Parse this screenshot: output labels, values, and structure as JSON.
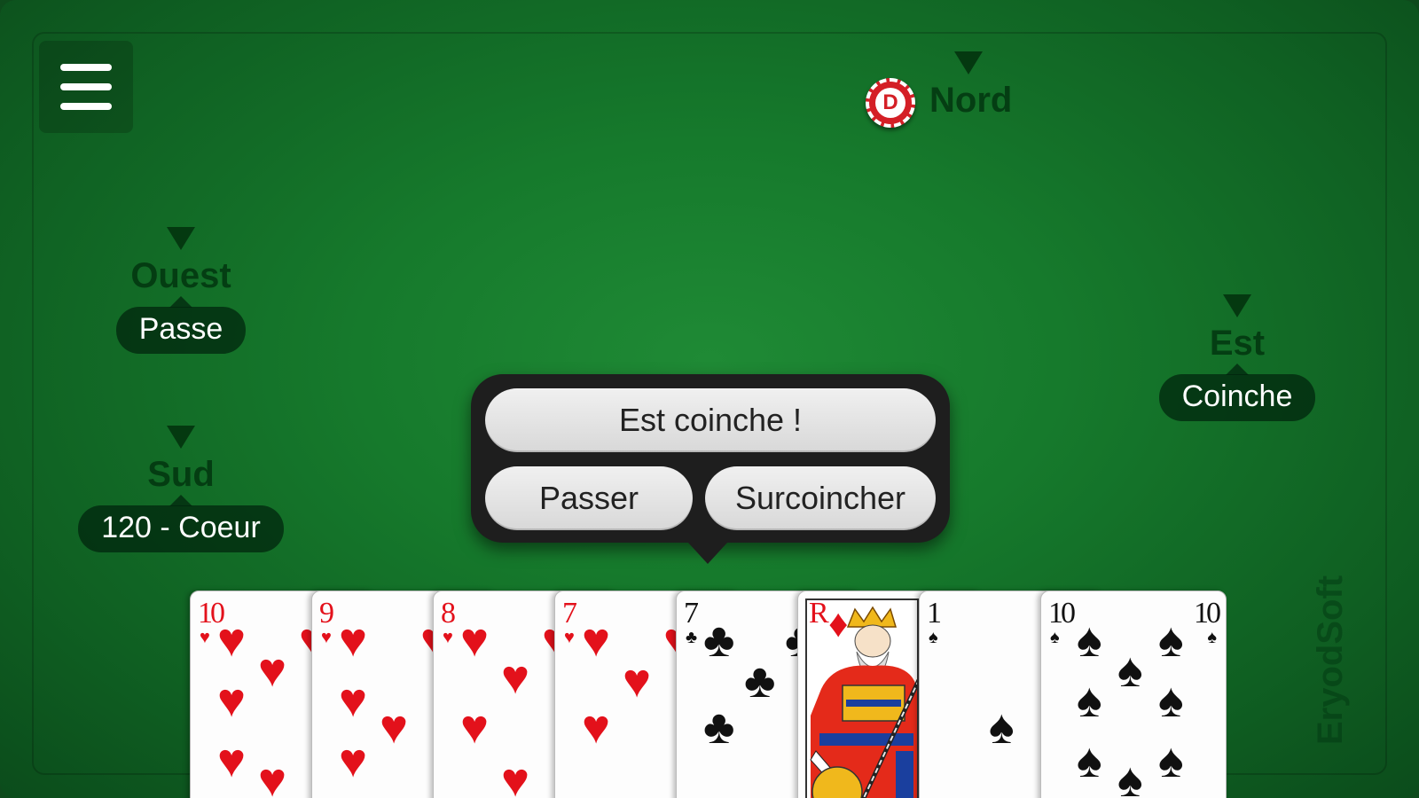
{
  "menu": {
    "icon": "hamburger-menu-icon"
  },
  "players": {
    "north": {
      "name": "Nord",
      "dealer_badge": "D"
    },
    "west": {
      "name": "Ouest",
      "bid": "Passe"
    },
    "east": {
      "name": "Est",
      "bid": "Coinche"
    },
    "south": {
      "name": "Sud",
      "bid": "120 - Coeur"
    }
  },
  "dialog": {
    "title_button": "Est coinche !",
    "pass_button": "Passer",
    "surcoinche_button": "Surcoincher"
  },
  "hand": [
    {
      "rank": "10",
      "suit": "♥",
      "color": "red"
    },
    {
      "rank": "9",
      "suit": "♥",
      "color": "red"
    },
    {
      "rank": "8",
      "suit": "♥",
      "color": "red"
    },
    {
      "rank": "7",
      "suit": "♥",
      "color": "red"
    },
    {
      "rank": "7",
      "suit": "♣",
      "color": "black"
    },
    {
      "rank": "R",
      "suit": "♦",
      "color": "red"
    },
    {
      "rank": "1",
      "suit": "♠",
      "color": "black"
    },
    {
      "rank": "10",
      "suit": "♠",
      "color": "black"
    }
  ],
  "watermark": "EryodSoft",
  "colors": {
    "felt": "#167a2c",
    "bubble": "#0b3a17",
    "dialog": "#1e1e1e",
    "red_suit": "#e3111b"
  }
}
